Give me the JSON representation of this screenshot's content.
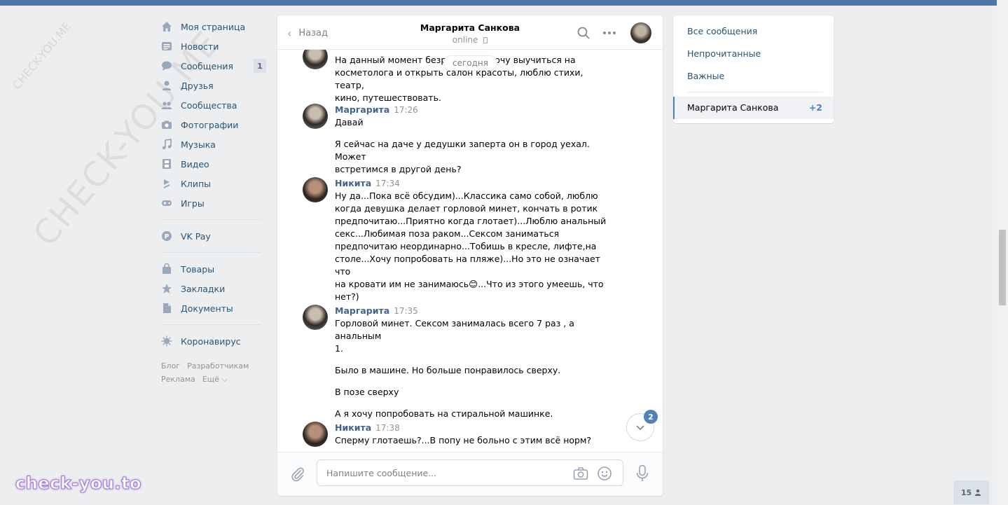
{
  "nav": {
    "items": [
      {
        "label": "Моя страница",
        "icon": "home-icon"
      },
      {
        "label": "Новости",
        "icon": "news-icon"
      },
      {
        "label": "Сообщения",
        "icon": "messages-icon",
        "badge": "1"
      },
      {
        "label": "Друзья",
        "icon": "friend-icon"
      },
      {
        "label": "Сообщества",
        "icon": "groups-icon"
      },
      {
        "label": "Фотографии",
        "icon": "camera-icon"
      },
      {
        "label": "Музыка",
        "icon": "music-note-icon"
      },
      {
        "label": "Видео",
        "icon": "film-icon"
      },
      {
        "label": "Клипы",
        "icon": "clips-icon"
      },
      {
        "label": "Игры",
        "icon": "gamepad-icon"
      },
      {
        "label": "VK Pay",
        "icon": "vkpay-icon"
      },
      {
        "label": "Товары",
        "icon": "shopping-bag-icon"
      },
      {
        "label": "Закладки",
        "icon": "star-icon"
      },
      {
        "label": "Документы",
        "icon": "document-icon"
      },
      {
        "label": "Коронавирус",
        "icon": "virus-icon"
      }
    ],
    "footer": {
      "blog": "Блог",
      "dev": "Разработчикам",
      "ads": "Реклама",
      "more": "Ещё ⌵"
    }
  },
  "watermark": {
    "large": "CHECK-YOU.ME",
    "small": "CHECK-YOU.ME",
    "brand": "check-you.to"
  },
  "chat": {
    "back_label": "Назад",
    "title": "Маргарита Санкова",
    "status": "online",
    "date_pill": "сегодня",
    "messages": [
      {
        "author": "",
        "time": "",
        "avatar": "m",
        "paragraphs": [
          "На данный момент безработная, хочу выучиться на\nкосметолога и открыть салон красоты, люблю стихи, театр,\nкино, путешествовать."
        ]
      },
      {
        "author": "Маргарита",
        "time": "17:26",
        "avatar": "m",
        "paragraphs": [
          "Давай",
          "Я сейчас на даче у дедушки заперта он в город уехал. Может\nвстретимся в другой день?"
        ]
      },
      {
        "author": "Никита",
        "time": "17:34",
        "avatar": "n",
        "paragraphs": [
          "Ну да...Пока всё обсудим)...Классика само собой, люблю\nкогда девушка делает горловой минет, кончать в ротик\nпредпочитаю...Приятно когда глотает)...Люблю анальный\nсекс...Любимая поза раком...Сексом заниматься\nпредпочитаю неординарно...Тобишь в кресле, лифте,на\nстоле...Хочу попробовать на пляже)...Но это не означает что\nна кровати им не занимаюсь😊...Что из этого умеешь, что\nнет?)"
        ]
      },
      {
        "author": "Маргарита",
        "time": "17:35",
        "avatar": "m",
        "paragraphs": [
          "Горловой минет. Сексом занималась всего 7 раз , а анальным\n1.",
          "Было в машине. Но больше понравилось сверху.",
          "В позе сверху",
          "А я хочу попробовать на стиральной машинке."
        ]
      },
      {
        "author": "Никита",
        "time": "17:38",
        "avatar": "n",
        "paragraphs": [
          "Сперму глотаешь?...В попу не больно с этим всё норм?"
        ]
      }
    ],
    "unread_badge": "2",
    "input_placeholder": "Напишите сообщение..."
  },
  "right_panel": {
    "all": "Все сообщения",
    "unread": "Непрочитанные",
    "important": "Важные",
    "active_name": "Маргарита Санкова",
    "active_count": "+2"
  },
  "online_count": "15"
}
